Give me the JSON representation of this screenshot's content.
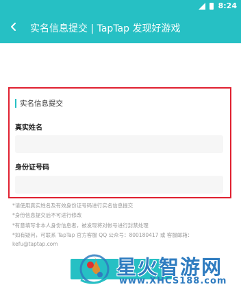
{
  "status_bar": {
    "time": "8:24"
  },
  "app_bar": {
    "title": "实名信息提交 | TapTap 发现好游戏",
    "back_icon": "chevron-left-icon"
  },
  "form": {
    "section_title": "实名信息提交",
    "name_label": "真实姓名",
    "name_value": "",
    "id_label": "身份证号码",
    "id_value": ""
  },
  "notes": [
    "*请使用真实姓名及有效身份证号码进行实名信息提交",
    "*身份信息提交后不可进行修改",
    "*有意填写非本人身份信息者，被发现将对帐号进行封禁处理",
    "*如有疑问，可联系 TapTap 官方客服 QQ 公众号：800180417 或 客服邮箱：",
    "kefu@taptap.com"
  ],
  "submit_label": "",
  "watermark": {
    "name": "星火智游网",
    "url": "www.XHCS188.com"
  },
  "colors": {
    "accent": "#26c0c4",
    "highlight_border": "#e02030",
    "watermark": "#2f7cc0"
  }
}
